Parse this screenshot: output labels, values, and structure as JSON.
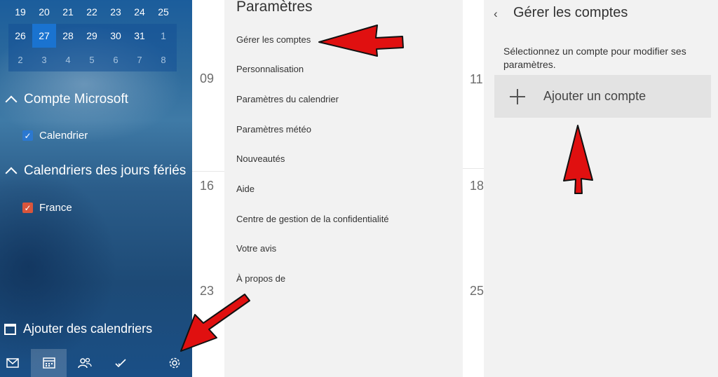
{
  "calendar": {
    "rows": [
      {
        "days": [
          "19",
          "20",
          "21",
          "22",
          "23",
          "24",
          "25"
        ]
      },
      {
        "days": [
          "26",
          "27",
          "28",
          "29",
          "30",
          "31",
          "1"
        ],
        "today": "27",
        "other_month": [
          "1"
        ]
      },
      {
        "days": [
          "2",
          "3",
          "4",
          "5",
          "6",
          "7",
          "8"
        ]
      }
    ]
  },
  "sidebar": {
    "sections": [
      {
        "title": "Compte Microsoft",
        "items": [
          {
            "label": "Calendrier",
            "color": "#2b78d0"
          }
        ]
      },
      {
        "title": "Calendriers des jours fériés",
        "items": [
          {
            "label": "France",
            "color": "#d9553b"
          }
        ]
      }
    ],
    "add_calendars": "Ajouter des calendriers",
    "nav": [
      "mail-icon",
      "calendar-icon",
      "people-icon",
      "todo-icon",
      "settings-icon"
    ]
  },
  "week": {
    "left": [
      "09",
      "16",
      "23"
    ],
    "right": [
      "11",
      "18",
      "25"
    ]
  },
  "settings": {
    "title": "Paramètres",
    "items": [
      "Gérer les comptes",
      "Personnalisation",
      "Paramètres du calendrier",
      "Paramètres météo",
      "Nouveautés",
      "Aide",
      "Centre de gestion de la confidentialité",
      "Votre avis",
      "À propos de"
    ]
  },
  "accounts": {
    "title": "Gérer les comptes",
    "description": "Sélectionnez un compte pour modifier ses paramètres.",
    "add_account": "Ajouter un compte"
  },
  "colors": {
    "accent": "#1a73d0",
    "annotation_arrow": "#e01010"
  }
}
